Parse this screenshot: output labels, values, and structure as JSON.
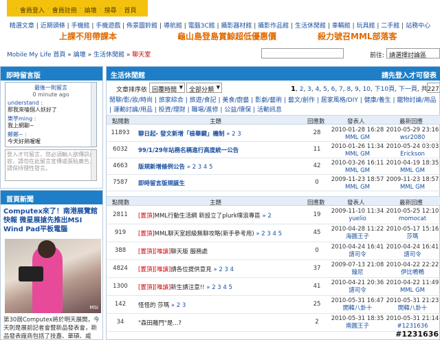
{
  "topnav": [
    "會員登入",
    "會員註冊",
    "論壇",
    "搜尋",
    "首頁"
  ],
  "links": [
    "精選文章",
    "近期頭條",
    "手機館",
    "手機遊戲",
    "佈景圖鈴館",
    "導航館",
    "電腦3C館",
    "攝影器材館",
    "攝影作品館",
    "生活休閒館",
    "車輛館",
    "玩具館",
    "二手館",
    "站務中心"
  ],
  "promos": [
    "上課不用帶課本",
    "龜山島登島賞鯨超低優惠價",
    "殺力號召MML部落客"
  ],
  "breadcrumb": {
    "home": "Mobile My Life 首頁",
    "sep": "»",
    "forum": "論壇",
    "section": "生活休閒館",
    "current": "聊天室"
  },
  "goto": {
    "label": "前往:",
    "value": "請選擇討論區"
  },
  "chat": {
    "title": "即時留言版",
    "first": "最後一則留言",
    "ago": "0 minute ago",
    "messages": [
      {
        "who": "understand :",
        "text": "那我來嗑個人妖好了"
      },
      {
        "who": "樂芋ming :",
        "text": "我上網聊~"
      },
      {
        "who": "鄭鄭~ :",
        "text": "今天好熱喔喔"
      }
    ],
    "input_placeholder": "登入才可留言，您必須輸入欲傳訊內容，請勿在此留言宣傳或張貼廣告，請保持理性發言。"
  },
  "news": {
    "title": "首頁新聞",
    "headline": "Computex來了！南港展覽館快報 微星展搶先推出MSI Wind Pad平板電腦",
    "photo_label": "MSI",
    "body": "第30屆Computex將於明天展開，今天則是展前記者會暨新品發表會，新品發表廠商包括了技嘉、華碩、威盛、微軟、創見、功..."
  },
  "main": {
    "title": "生活休閒館",
    "login_note": "請先登入才可發表",
    "sort_label": "文章排序依",
    "sort_value": "回覆時間",
    "filter_value": "全部分類",
    "pager": {
      "current": "1",
      "pages": [
        "2",
        "3",
        "4",
        "5",
        "6",
        "7",
        "8",
        "9",
        "10"
      ],
      "next10": "下10頁",
      "next": "下一頁",
      "total": "共227頁"
    },
    "categories": "閒聊/影/妝/時尚 | 旅家綜合 | 旅遊/食記 | 美食/廚藝 | 影劇/藝術 | 藝文/創作 | 居家風格/DIY | 健康/養生 | 寵物討論/用品 | 運動討論/用品 | 投資/理財 | 職場/進修 | 公益/環保 | 活動訊息",
    "headers": {
      "views": "點閱數",
      "topic": "主題",
      "replies": "回應數",
      "author": "發表人",
      "last": "最新回應"
    }
  },
  "pinned": [
    {
      "views": "11893",
      "title": "聊日起- 發文新增「檢舉鍵」機制",
      "pages": "» 2 3",
      "replies": "28",
      "adate": "2010-01-28 16:28",
      "author": "MML GM",
      "ldate": "2010-05-29 23:16",
      "lname": "wsr2080"
    },
    {
      "views": "6032",
      "title": "99/1/29年站務名稱進行高度統一公告",
      "pages": "",
      "replies": "11",
      "adate": "2010-01-26 11:34",
      "author": "MML GM",
      "ldate": "2010-05-24 03:03",
      "lname": "Erickson"
    },
    {
      "views": "4663",
      "title": "版規新增條例公告",
      "pages": "» 2 3 4 5",
      "replies": "42",
      "adate": "2010-03-26 16:11",
      "author": "MML GM",
      "ldate": "2010-04-19 18:35",
      "lname": "MML GM"
    },
    {
      "views": "7587",
      "title": "即時留言版規誕生",
      "pages": "",
      "replies": "0",
      "adate": "2009-11-23 18:57",
      "author": "MML GM",
      "ldate": "2009-11-23 18:57",
      "lname": "MML GM"
    }
  ],
  "topics": [
    {
      "views": "2811",
      "tag": "[置頂]",
      "title": "MML行動生活網 新設立了plurk噗浪專區",
      "pages": "» 2",
      "replies": "19",
      "adate": "2009-11-10 11:34",
      "author": "yuelio",
      "ldate": "2010-05-25 12:10",
      "lname": "momocat"
    },
    {
      "views": "919",
      "tag": "[置頂]",
      "title": "MML聊天室超級無聊攻略(新手參考用)",
      "pages": "» 2 3 4 5",
      "replies": "45",
      "adate": "2010-04-28 11:22",
      "author": "海圓王子",
      "ldate": "2010-05-17 15:16",
      "lname": "莎瑪"
    },
    {
      "views": "388",
      "tag": "[置頂][唯讀]",
      "title": "聊天版 服務處",
      "pages": "",
      "replies": "0",
      "adate": "2010-04-24 16:41",
      "author": "譜司令",
      "ldate": "2010-04-24 16:41",
      "lname": "譜司令"
    },
    {
      "views": "4824",
      "tag": "[置頂][唯讀]",
      "title": "請各位提供意見",
      "pages": "» 2 3 4",
      "replies": "37",
      "adate": "2009-07-13 21:08",
      "author": "鐘尼",
      "ldate": "2010-04-22 22:22",
      "lname": "伊比鴨鴨"
    },
    {
      "views": "1300",
      "tag": "[置頂][唯讀]",
      "title": "新生請注意!!",
      "pages": "» 2 3 4 5",
      "replies": "41",
      "adate": "2010-04-21 20:36",
      "author": "譜司令",
      "ldate": "2010-04-22 11:49",
      "lname": "MML GM"
    },
    {
      "views": "142",
      "tag": "",
      "title": "怪怪的 莎瑪",
      "pages": "» 2 3",
      "replies": "25",
      "adate": "2010-05-31 16:47",
      "author": "開韓八卦十",
      "ldate": "2010-05-31 21:23",
      "lname": "開韓八卦十"
    },
    {
      "views": "34",
      "tag": "",
      "title": "\"森田雕門\"是...?",
      "pages": "",
      "replies": "2",
      "adate": "2010-05-31 18:35",
      "author": "南圓王子",
      "ldate": "2010-05-31 21:14",
      "lname": "#1231636"
    }
  ],
  "watermark": "#1231636"
}
